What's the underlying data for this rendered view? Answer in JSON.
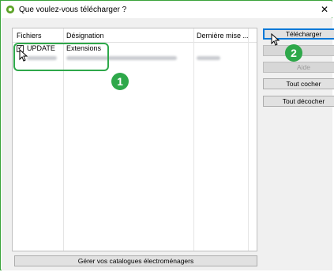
{
  "window": {
    "title": "Que voulez-vous télécharger ?",
    "close_glyph": "✕"
  },
  "list": {
    "columns": [
      "Fichiers",
      "Désignation",
      "Dernière mise ..."
    ],
    "rows": [
      {
        "checked": true,
        "file": "UPDATE",
        "designation": "Extensions"
      }
    ]
  },
  "buttons": {
    "download": "Télécharger",
    "help": "Aide",
    "check_all": "Tout cocher",
    "uncheck_all": "Tout décocher",
    "manage_catalogs": "Gérer vos catalogues électroménagers"
  },
  "annotations": {
    "badge1": "1",
    "badge2": "2",
    "accent": "#2ea84a"
  },
  "icons": {
    "app": "app-logo-icon",
    "close": "close-icon",
    "cursor": "mouse-pointer-icon"
  }
}
